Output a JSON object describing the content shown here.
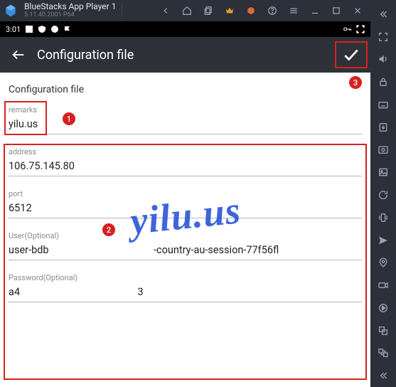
{
  "bluestacks": {
    "title": "BlueStacks App Player 1",
    "version": "5.11.40.2001 P64"
  },
  "status": {
    "time": "3:01"
  },
  "header": {
    "title": "Configuration file"
  },
  "body": {
    "section_title": "Configuration file",
    "remarks": {
      "label": "remarks",
      "value": "yilu.us"
    },
    "address": {
      "label": "address",
      "value": "106.75.145.80"
    },
    "port": {
      "label": "port",
      "value": "6512"
    },
    "user": {
      "label": "User(Optional)",
      "value": "user-bdb                                         -country-au-session-77f56fl"
    },
    "password": {
      "label": "Password(Optional)",
      "value": "a4                                              3"
    }
  },
  "watermark": "yilu.us",
  "badges": {
    "b1": "1",
    "b2": "2",
    "b3": "3"
  }
}
